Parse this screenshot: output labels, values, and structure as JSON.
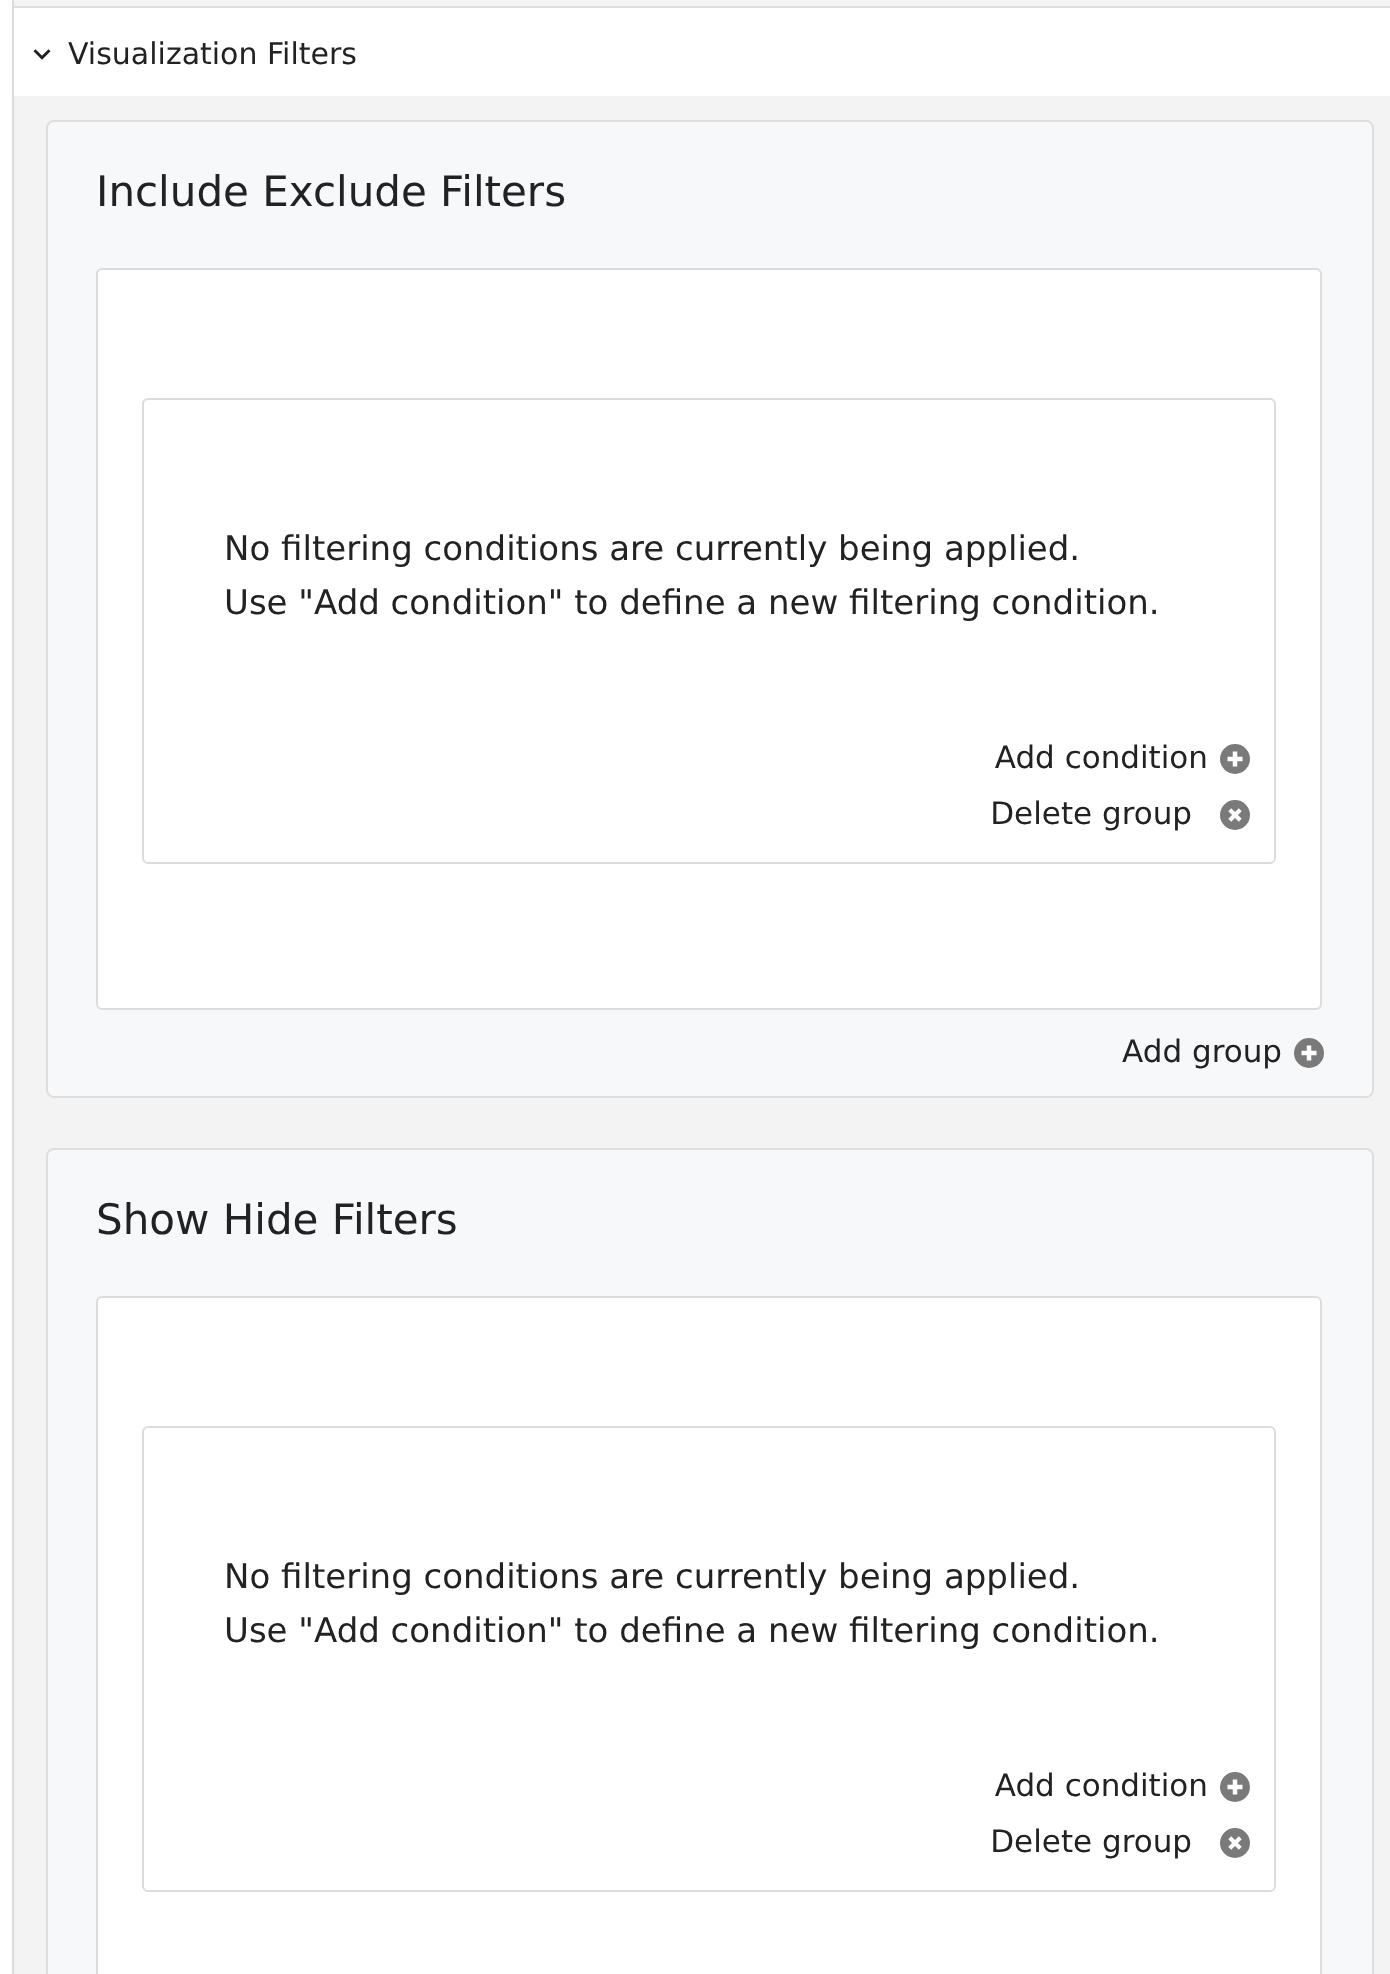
{
  "section": {
    "title": "Visualization Filters",
    "expanded": true
  },
  "panels": [
    {
      "title": "Include Exclude Filters",
      "groups": [
        {
          "messages": [
            "No filtering conditions are currently being applied.",
            "Use \"Add condition\" to define a new filtering condition."
          ],
          "actions": [
            {
              "kind": "add",
              "label": "Add condition"
            },
            {
              "kind": "delete",
              "label": "Delete group"
            }
          ]
        }
      ],
      "footer_action": {
        "kind": "add",
        "label": "Add group"
      }
    },
    {
      "title": "Show Hide Filters",
      "groups": [
        {
          "messages": [
            "No filtering conditions are currently being applied.",
            "Use \"Add condition\" to define a new filtering condition."
          ],
          "actions": [
            {
              "kind": "add",
              "label": "Add condition"
            },
            {
              "kind": "delete",
              "label": "Delete group"
            }
          ]
        }
      ]
    }
  ]
}
